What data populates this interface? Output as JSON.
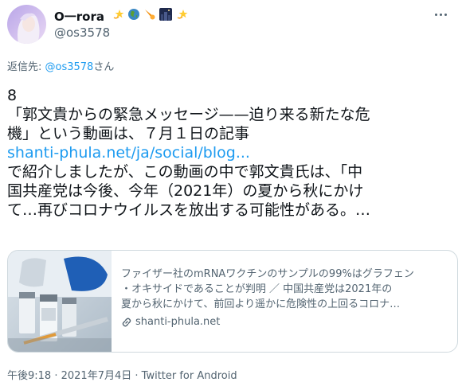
{
  "author": {
    "display_name": "O一rora",
    "handle": "@os3578",
    "emoji_icons": [
      "dizzy-star-icon",
      "globe-icon",
      "comet-icon",
      "night-city-icon",
      "dizzy-star-icon"
    ]
  },
  "reply": {
    "prefix": "返信先: ",
    "mention": "@os3578",
    "suffix": "さん"
  },
  "tweet": {
    "lines": [
      "8",
      "「郭文貴からの緊急メッセージ——迫り来る新たな危",
      "機」という動画は、７月１日の記事"
    ],
    "link": "shanti-phula.net/ja/social/blog...",
    "lines_after": [
      "で紹介しましたが、この動画の中で郭文貴氏は、「中",
      "国共産党は今後、今年（2021年）の夏から秋にかけ",
      "て…再びコロナウイルスを放出する可能性がある。…"
    ]
  },
  "card": {
    "title_line_1": "ファイザー社のmRNAワクチンのサンプルの99%はグラフェン",
    "title_line_2": "・オキサイドであることが判明 ／ 中国共産党は2021年の",
    "title_line_3": "夏から秋にかけて、前回より遥かに危険性の上回るコロナ…",
    "domain": "shanti-phula.net",
    "image_icon": "vaccine-vials-syringe-image"
  },
  "meta": {
    "time": "午後9:18",
    "separator": " · ",
    "date": "2021年7月4日",
    "source": "Twitter for Android"
  },
  "colors": {
    "accent": "#1d9bf0",
    "text": "#0f1419",
    "secondary": "#536471",
    "border": "#cfd9de"
  }
}
